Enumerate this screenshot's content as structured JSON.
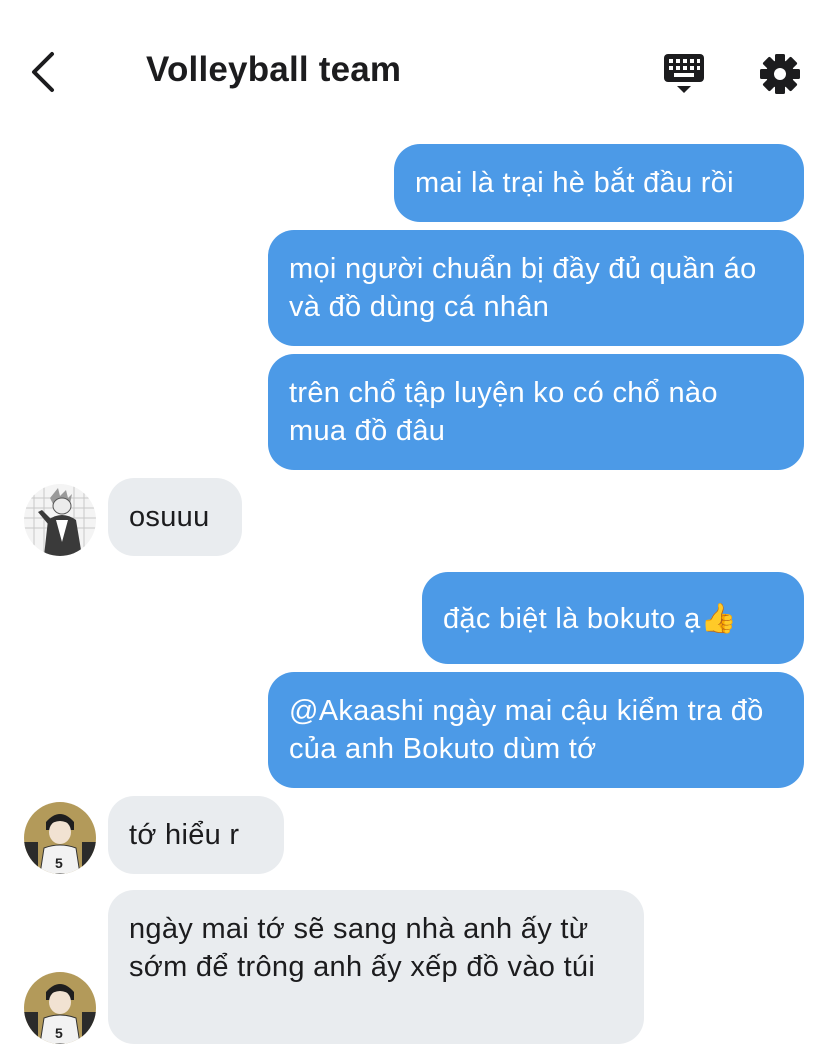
{
  "header": {
    "title": "Volleyball team",
    "back_icon": "chevron-left-icon",
    "keyboard_icon": "keyboard-icon",
    "settings_icon": "gear-icon"
  },
  "colors": {
    "outgoing_bubble": "#4c9ae7",
    "incoming_bubble": "#e9ecef",
    "text_dark": "#1c1c1e"
  },
  "messages": [
    {
      "sender": "me",
      "text": "mai là trại hè bắt đầu rồi"
    },
    {
      "sender": "me",
      "text": "mọi người chuẩn bị đầy đủ quần áo và đồ dùng cá nhân"
    },
    {
      "sender": "me",
      "text": "trên chổ tập luyện ko có chổ nào mua đồ đâu"
    },
    {
      "sender": "bokuto",
      "text": "osuuu"
    },
    {
      "sender": "me",
      "text": "đặc biệt là bokuto ạ",
      "emoji": "👍"
    },
    {
      "sender": "me",
      "text": "@Akaashi ngày mai cậu kiểm tra đồ của anh Bokuto dùm tớ"
    },
    {
      "sender": "akaashi",
      "text": "tớ hiểu r"
    },
    {
      "sender": "akaashi",
      "text": "ngày mai tớ sẽ sang nhà anh ấy từ sớm để trông anh ấy xếp đồ vào túi"
    }
  ]
}
